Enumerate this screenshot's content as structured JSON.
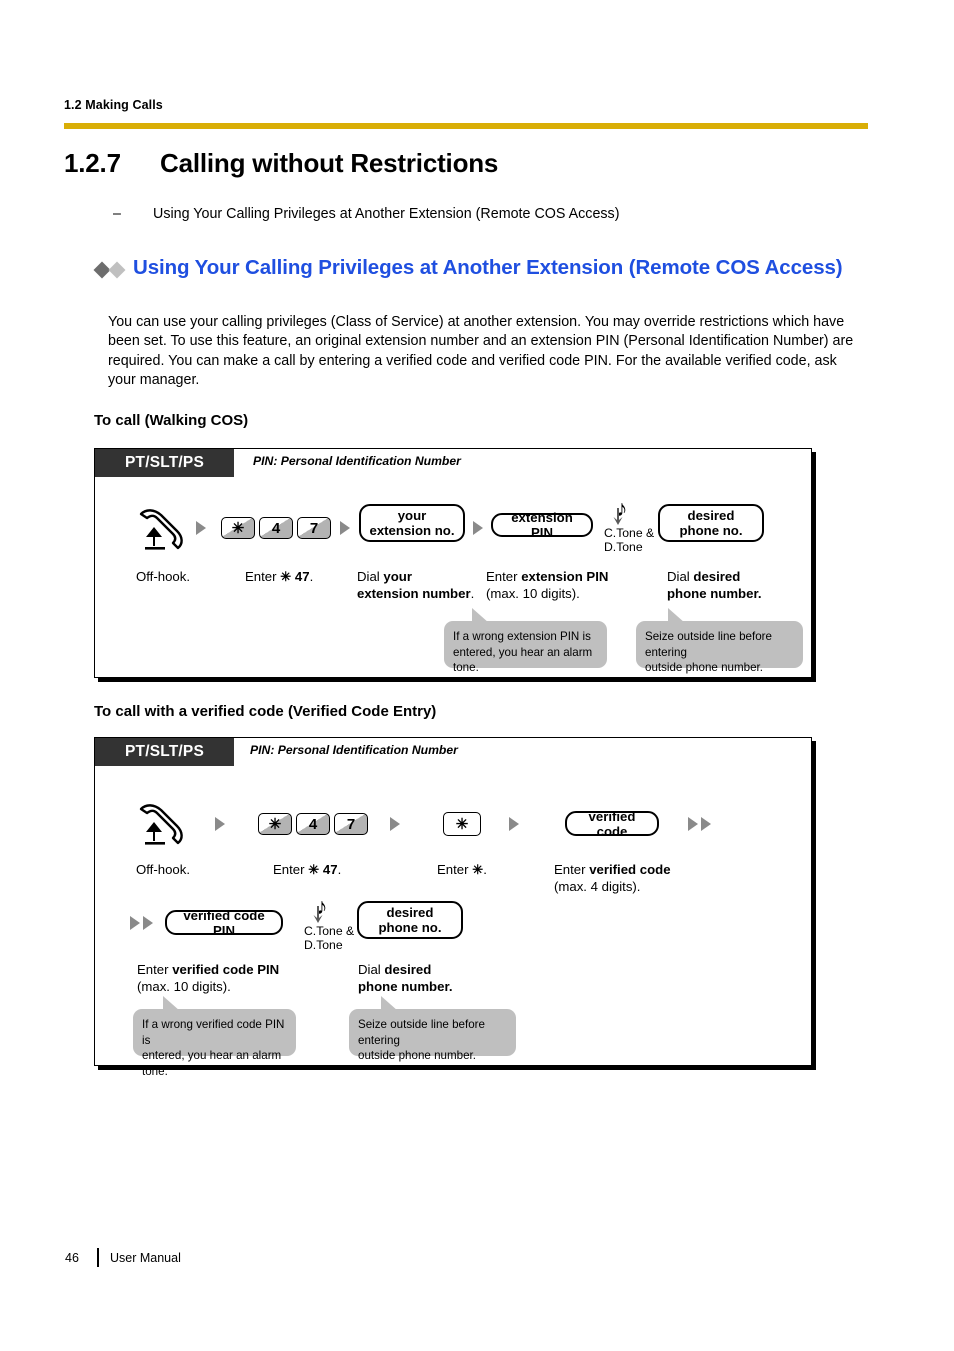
{
  "header": {
    "section_label": "1.2 Making Calls",
    "rule_color": "#d9ae06"
  },
  "chapter": {
    "number": "1.2.7",
    "title": "Calling without Restrictions"
  },
  "toc_list": [
    {
      "dash": "–",
      "text": "Using Your Calling Privileges at Another Extension (Remote COS Access)"
    }
  ],
  "feature_heading": {
    "text": "Using Your Calling Privileges at Another Extension (Remote COS Access)",
    "color": "#1f4fe0",
    "bullet_colors": [
      "#6d6d6d",
      "#c0c0c0"
    ]
  },
  "body_paragraph": "You can use your calling privileges (Class of Service) at another extension. You may override restrictions which have been set. To use this feature, an original extension number and an extension PIN (Personal Identification Number) are required. You can make a call by entering a verified code and verified code PIN. For the available verified code, ask your manager.",
  "diagram1": {
    "subheading": "To call (Walking COS)",
    "tab_label": "PT/SLT/PS",
    "pin_note": "PIN: Personal Identification Number",
    "keys": [
      "✳",
      "4",
      "7"
    ],
    "fields": {
      "your_extension_no": "your\nextension no.",
      "your_extension_no_l1": "your",
      "your_extension_no_l2": "extension no.",
      "extension_pin": "extension PIN",
      "desired_phone_no_l1": "desired",
      "desired_phone_no_l2": "phone no."
    },
    "tone_label_l1": "C.Tone &",
    "tone_label_l2": "D.Tone",
    "captions": {
      "offhook": "Off-hook.",
      "enter47_pre": "Enter ",
      "enter47_bold": "✳ 47",
      "enter47_post": ".",
      "dial_ext_l1_pre": "Dial ",
      "dial_ext_l1_bold": "your",
      "dial_ext_l2_bold": "extension number",
      "dial_ext_l2_post": ".",
      "enter_pin_pre": "Enter ",
      "enter_pin_bold": "extension PIN",
      "enter_pin_l2": "(max. 10 digits).",
      "dial_phone_l1_pre": "Dial ",
      "dial_phone_l1_bold": "desired",
      "dial_phone_l2_bold": "phone number."
    },
    "bubbles": [
      {
        "line1": "If a wrong extension PIN is",
        "line2": "entered, you hear an alarm tone."
      },
      {
        "line1": "Seize outside line before entering",
        "line2": "outside phone number."
      }
    ]
  },
  "diagram2": {
    "subheading": "To call with a verified code (Verified Code Entry)",
    "tab_label": "PT/SLT/PS",
    "pin_note": "PIN: Personal Identification Number",
    "keys": [
      "✳",
      "4",
      "7"
    ],
    "star_key": "✳",
    "fields": {
      "verified_code": "verified code",
      "verified_code_pin": "verified code PIN",
      "desired_phone_no_l1": "desired",
      "desired_phone_no_l2": "phone no."
    },
    "tone_label_l1": "C.Tone &",
    "tone_label_l2": "D.Tone",
    "captions": {
      "offhook": "Off-hook.",
      "enter47_pre": "Enter ",
      "enter47_bold": "✳ 47",
      "enter47_post": ".",
      "enter_star_pre": "Enter ",
      "enter_star_bold": "✳",
      "enter_star_post": ".",
      "enter_vcode_pre": "Enter ",
      "enter_vcode_bold": "verified code",
      "enter_vcode_l2": "(max. 4 digits).",
      "enter_vpin_pre": "Enter ",
      "enter_vpin_bold": "verified code PIN",
      "enter_vpin_l2": "(max. 10 digits).",
      "dial_phone_l1_pre": "Dial ",
      "dial_phone_l1_bold": "desired",
      "dial_phone_l2_bold": "phone number."
    },
    "bubbles": [
      {
        "line1": "If a wrong verified code PIN is",
        "line2": "entered, you hear an alarm tone."
      },
      {
        "line1": "Seize outside line before entering",
        "line2": "outside phone number."
      }
    ]
  },
  "footer": {
    "page_number": "46",
    "document_title": "User Manual"
  }
}
